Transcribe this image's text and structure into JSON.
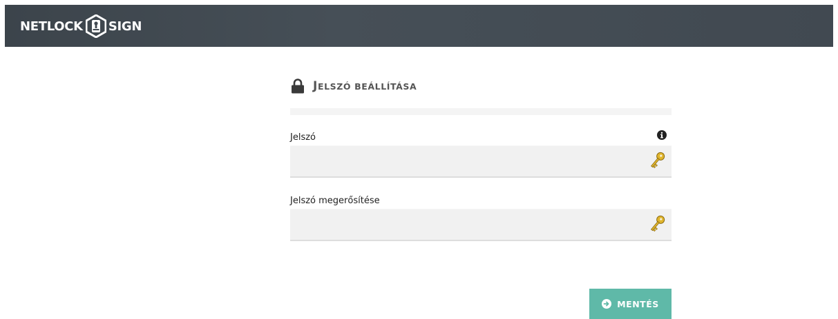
{
  "header": {
    "logo_left": "NETLOCK",
    "logo_right": "SIGN"
  },
  "panel": {
    "title_initial": "J",
    "title_rest": "ELSZÓ BEÁLLÍTÁSA",
    "icon": "lock-icon"
  },
  "fields": {
    "password": {
      "label": "Jelszó",
      "value": "",
      "info_icon": "info-icon",
      "trailing_icon": "key-icon"
    },
    "password_confirm": {
      "label": "Jelszó megerősítése",
      "value": "",
      "trailing_icon": "key-icon"
    }
  },
  "actions": {
    "save_label": "MENTÉS",
    "save_icon": "arrow-circle-right-icon",
    "save_color": "#5fb9a8"
  },
  "colors": {
    "topbar": "#414951",
    "accent": "#5fb9a8",
    "key_gold": "#d9a521"
  }
}
